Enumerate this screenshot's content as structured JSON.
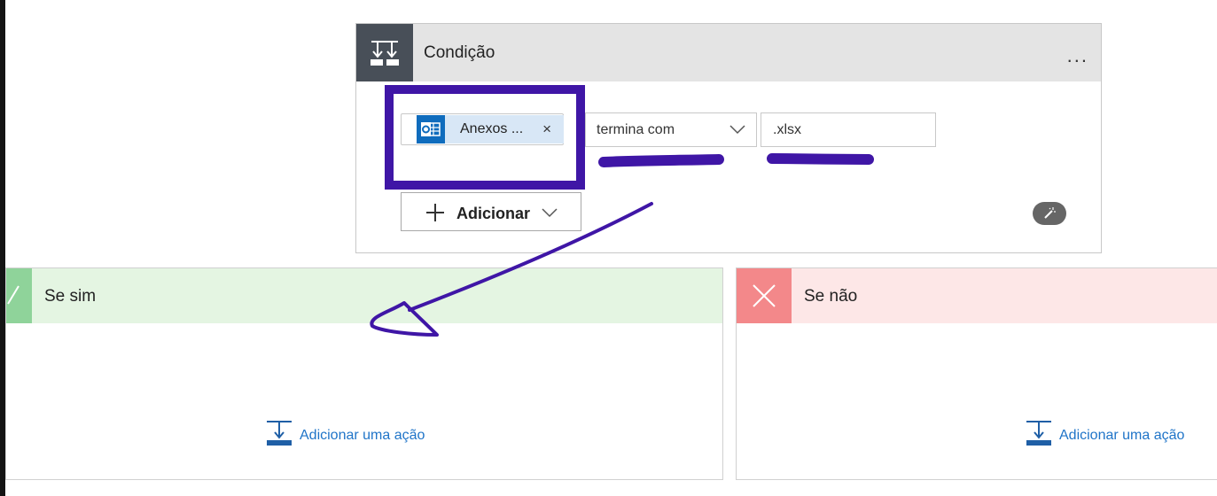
{
  "condition": {
    "title": "Condição",
    "more_label": "...",
    "token": {
      "label": "Anexos ...",
      "close": "×",
      "icon": "outlook-icon"
    },
    "operator": {
      "value": "termina com"
    },
    "value_input": {
      "value": ".xlsx"
    },
    "add_button": {
      "label": "Adicionar"
    }
  },
  "branches": {
    "yes": {
      "title": "Se sim",
      "add_action_label": "Adicionar uma ação",
      "color": "#8fd39a"
    },
    "no": {
      "title": "Se não",
      "add_action_label": "Adicionar uma ação",
      "color": "#f3888a"
    }
  },
  "colors": {
    "accent": "#1f74c8",
    "annotation": "#3f16a6"
  }
}
